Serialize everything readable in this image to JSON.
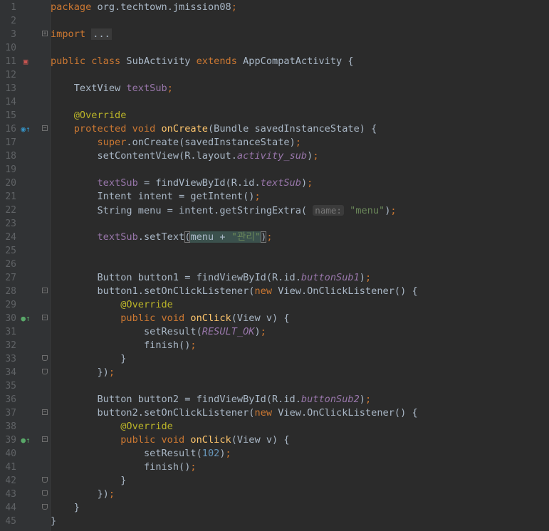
{
  "lines": [
    {
      "n": "1",
      "code": [
        [
          "kw",
          "package"
        ],
        [
          "p",
          " org.techtown.jmission08"
        ],
        [
          "kw",
          ";"
        ]
      ]
    },
    {
      "n": "2",
      "code": []
    },
    {
      "n": "3",
      "fold": "+",
      "code": [
        [
          "kw",
          "import"
        ],
        [
          "p",
          " "
        ],
        [
          "ellip",
          "..."
        ]
      ]
    },
    {
      "n": "10",
      "code": []
    },
    {
      "n": "11",
      "icon": "class-icon",
      "code": [
        [
          "kw",
          "public class "
        ],
        [
          "p",
          "SubActivity "
        ],
        [
          "kw",
          "extends "
        ],
        [
          "p",
          "AppCompatActivity {"
        ]
      ]
    },
    {
      "n": "12",
      "code": []
    },
    {
      "n": "13",
      "code": [
        [
          "p",
          "    TextView "
        ],
        [
          "fld",
          "textSub"
        ],
        [
          "kw",
          ";"
        ]
      ]
    },
    {
      "n": "14",
      "code": []
    },
    {
      "n": "15",
      "code": [
        [
          "an",
          "    @Override"
        ]
      ]
    },
    {
      "n": "16",
      "icon": "override-icon",
      "fold": "-",
      "code": [
        [
          "kw",
          "    protected void "
        ],
        [
          "fn",
          "onCreate"
        ],
        [
          "p",
          "(Bundle savedInstanceState) {"
        ]
      ]
    },
    {
      "n": "17",
      "code": [
        [
          "kw",
          "        super"
        ],
        [
          "p",
          "."
        ],
        [
          "p",
          "onCreate(savedInstanceState)"
        ],
        [
          "kw",
          ";"
        ]
      ]
    },
    {
      "n": "18",
      "code": [
        [
          "p",
          "        setContentView(R.layout."
        ],
        [
          "ifld",
          "activity_sub"
        ],
        [
          "p",
          ")"
        ],
        [
          "kw",
          ";"
        ]
      ]
    },
    {
      "n": "19",
      "code": []
    },
    {
      "n": "20",
      "code": [
        [
          "fld",
          "        textSub"
        ],
        [
          "p",
          " = findViewById(R.id."
        ],
        [
          "ifld",
          "textSub"
        ],
        [
          "p",
          ")"
        ],
        [
          "kw",
          ";"
        ]
      ]
    },
    {
      "n": "21",
      "code": [
        [
          "p",
          "        Intent intent = getIntent()"
        ],
        [
          "kw",
          ";"
        ]
      ]
    },
    {
      "n": "22",
      "code": [
        [
          "p",
          "        String menu = intent.getStringExtra( "
        ],
        [
          "hint",
          "name:"
        ],
        [
          "str",
          " \"menu\""
        ],
        [
          "p",
          ")"
        ],
        [
          "kw",
          ";"
        ]
      ]
    },
    {
      "n": "23",
      "code": []
    },
    {
      "n": "24",
      "code": [
        [
          "fld",
          "        textSub"
        ],
        [
          "p",
          ".setText"
        ],
        [
          "pm",
          "("
        ],
        [
          "hl",
          "menu + "
        ],
        [
          "hlstr",
          "\"관리\""
        ],
        [
          "pm",
          ")"
        ],
        [
          "kw",
          ";"
        ]
      ]
    },
    {
      "n": "25",
      "code": []
    },
    {
      "n": "26",
      "code": []
    },
    {
      "n": "27",
      "code": [
        [
          "p",
          "        Button button1 = findViewById(R.id."
        ],
        [
          "ifld",
          "buttonSub1"
        ],
        [
          "p",
          ")"
        ],
        [
          "kw",
          ";"
        ]
      ]
    },
    {
      "n": "28",
      "fold": "-",
      "code": [
        [
          "p",
          "        button1.setOnClickListener("
        ],
        [
          "kw",
          "new "
        ],
        [
          "p",
          "View.OnClickListener() {"
        ]
      ]
    },
    {
      "n": "29",
      "code": [
        [
          "an",
          "            @Override"
        ]
      ]
    },
    {
      "n": "30",
      "icon": "implements-icon",
      "fold": "-",
      "code": [
        [
          "kw",
          "            public void "
        ],
        [
          "fn",
          "onClick"
        ],
        [
          "p",
          "(View v) {"
        ]
      ]
    },
    {
      "n": "31",
      "code": [
        [
          "p",
          "                setResult("
        ],
        [
          "ifld",
          "RESULT_OK"
        ],
        [
          "p",
          ")"
        ],
        [
          "kw",
          ";"
        ]
      ]
    },
    {
      "n": "32",
      "code": [
        [
          "p",
          "                finish()"
        ],
        [
          "kw",
          ";"
        ]
      ]
    },
    {
      "n": "33",
      "fold": "e",
      "code": [
        [
          "p",
          "            }"
        ]
      ]
    },
    {
      "n": "34",
      "fold": "e",
      "code": [
        [
          "p",
          "        })"
        ],
        [
          "kw",
          ";"
        ]
      ]
    },
    {
      "n": "35",
      "code": []
    },
    {
      "n": "36",
      "code": [
        [
          "p",
          "        Button button2 = findViewById(R.id."
        ],
        [
          "ifld",
          "buttonSub2"
        ],
        [
          "p",
          ")"
        ],
        [
          "kw",
          ";"
        ]
      ]
    },
    {
      "n": "37",
      "fold": "-",
      "code": [
        [
          "p",
          "        button2.setOnClickListener("
        ],
        [
          "kw",
          "new "
        ],
        [
          "p",
          "View.OnClickListener() {"
        ]
      ]
    },
    {
      "n": "38",
      "code": [
        [
          "an",
          "            @Override"
        ]
      ]
    },
    {
      "n": "39",
      "icon": "implements-icon",
      "fold": "-",
      "code": [
        [
          "kw",
          "            public void "
        ],
        [
          "fn",
          "onClick"
        ],
        [
          "p",
          "(View v) {"
        ]
      ]
    },
    {
      "n": "40",
      "code": [
        [
          "p",
          "                setResult("
        ],
        [
          "num",
          "102"
        ],
        [
          "p",
          ")"
        ],
        [
          "kw",
          ";"
        ]
      ]
    },
    {
      "n": "41",
      "code": [
        [
          "p",
          "                finish()"
        ],
        [
          "kw",
          ";"
        ]
      ]
    },
    {
      "n": "42",
      "fold": "e",
      "code": [
        [
          "p",
          "            }"
        ]
      ]
    },
    {
      "n": "43",
      "fold": "e",
      "code": [
        [
          "p",
          "        })"
        ],
        [
          "kw",
          ";"
        ]
      ]
    },
    {
      "n": "44",
      "fold": "e",
      "code": [
        [
          "p",
          "    }"
        ]
      ]
    },
    {
      "n": "45",
      "code": [
        [
          "p",
          "}"
        ]
      ]
    }
  ],
  "icons": {
    "class-icon": {
      "glyph": "▣",
      "color": "#c75450"
    },
    "override-icon": {
      "glyph": "◉↑",
      "color": "#3592c4"
    },
    "implements-icon": {
      "glyph": "●↑",
      "color": "#59a869"
    }
  }
}
